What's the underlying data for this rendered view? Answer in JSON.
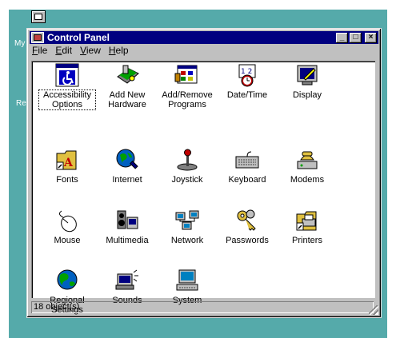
{
  "desktop": {
    "labels": [
      "My",
      "Re"
    ]
  },
  "window": {
    "title": "Control Panel",
    "controls": {
      "minimize": "_",
      "maximize": "□",
      "close": "×"
    },
    "menu": [
      "File",
      "Edit",
      "View",
      "Help"
    ]
  },
  "items": [
    {
      "label": "Accessibility Options",
      "icon": "accessibility-icon"
    },
    {
      "label": "Add New Hardware",
      "icon": "add-hardware-icon"
    },
    {
      "label": "Add/Remove Programs",
      "icon": "add-remove-programs-icon"
    },
    {
      "label": "Date/Time",
      "icon": "date-time-icon"
    },
    {
      "label": "Display",
      "icon": "display-icon"
    },
    {
      "label": "Fonts",
      "icon": "fonts-icon"
    },
    {
      "label": "Internet",
      "icon": "internet-icon"
    },
    {
      "label": "Joystick",
      "icon": "joystick-icon"
    },
    {
      "label": "Keyboard",
      "icon": "keyboard-icon"
    },
    {
      "label": "Modems",
      "icon": "modems-icon"
    },
    {
      "label": "Mouse",
      "icon": "mouse-icon"
    },
    {
      "label": "Multimedia",
      "icon": "multimedia-icon"
    },
    {
      "label": "Network",
      "icon": "network-icon"
    },
    {
      "label": "Passwords",
      "icon": "passwords-icon"
    },
    {
      "label": "Printers",
      "icon": "printers-icon"
    },
    {
      "label": "Regional Settings",
      "icon": "regional-settings-icon"
    },
    {
      "label": "Sounds",
      "icon": "sounds-icon"
    },
    {
      "label": "System",
      "icon": "system-icon"
    }
  ],
  "status": {
    "count": "18 object(s)"
  },
  "colors": {
    "desktop": "#55aaaa",
    "titlebar": "#000080",
    "face": "#c0c0c0"
  }
}
